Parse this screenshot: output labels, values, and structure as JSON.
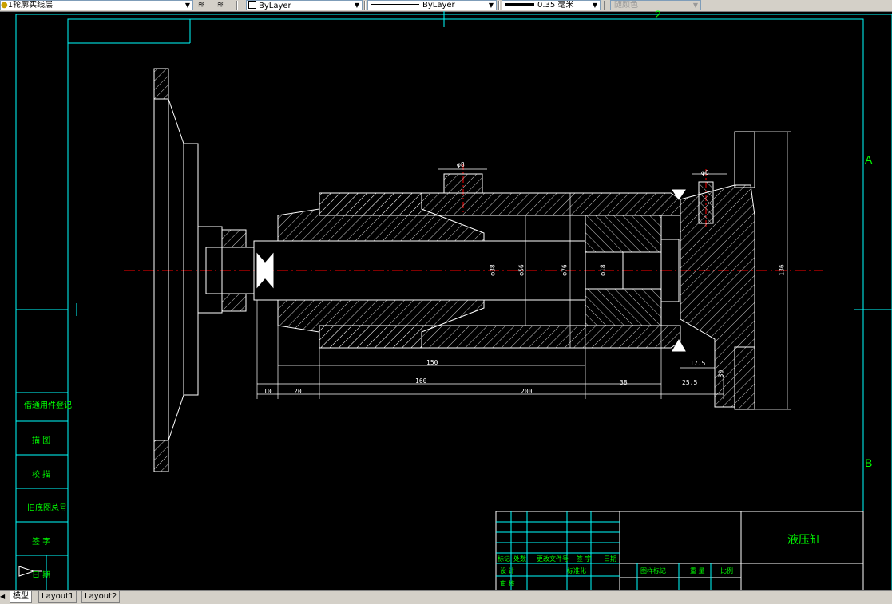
{
  "toolbar": {
    "layer_name": "1轮廓实线层",
    "color_value": "ByLayer",
    "linetype_value": "ByLayer",
    "lineweight_value": "0.35 毫米",
    "plotstyle_value": "随颜色"
  },
  "border_marks": {
    "top_zone": "2",
    "right_zone_a": "A",
    "right_zone_b": "B"
  },
  "left_stamp_labels": [
    "借通用件登记",
    "描  图",
    "校  描",
    "旧底图总号",
    "签  字",
    "日  期"
  ],
  "dimensions": {
    "d_top_left": "φ8",
    "d_top_right": "φ6",
    "d_bore_small": "φ38",
    "d_bore_mid": "φ56",
    "d_bore_large": "φ76",
    "d_rod": "φ18",
    "d_height": "136",
    "d_150": "150",
    "d_17_5": "17.5",
    "d_10": "10",
    "d_20": "20",
    "d_160": "160",
    "d_200": "200",
    "d_38": "38",
    "d_25_5": "25.5",
    "d_30": "30"
  },
  "title_block": {
    "part_name": "液压缸",
    "row_labels": [
      "标记",
      "处数",
      "更改文件号",
      "签  字",
      "日期"
    ],
    "row_labels_2": [
      "设  计",
      "标准化"
    ],
    "row_labels_3": [
      "审  核"
    ],
    "stage_labels": [
      "图样标记",
      "重  量",
      "比例"
    ]
  },
  "tabs": {
    "model": "模型",
    "layout1": "Layout1",
    "layout2": "Layout2"
  },
  "colors": {
    "background": "#000000",
    "outline": "#ffffff",
    "frame": "#00ffff",
    "centerline": "#ff0000",
    "text": "#00ff00"
  }
}
